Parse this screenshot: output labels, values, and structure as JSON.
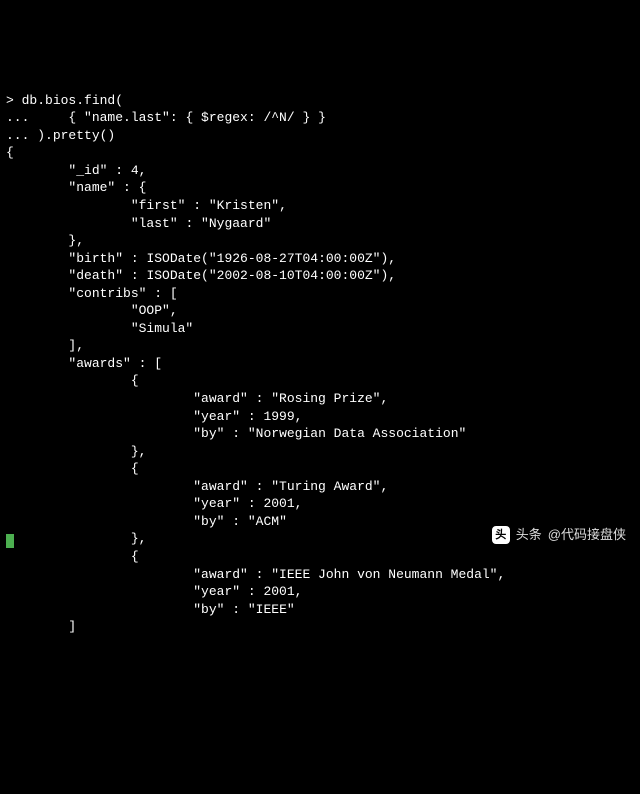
{
  "prompt": "> ",
  "continuation": "... ",
  "command": {
    "line1": "db.bios.find(",
    "line2": "    { \"name.last\": { $regex: /^N/ } }",
    "line3": ").pretty()"
  },
  "result": {
    "open": "{",
    "id_key": "\"_id\"",
    "id_val": "4",
    "name_key": "\"name\"",
    "name_open": "{",
    "first_key": "\"first\"",
    "first_val": "\"Kristen\"",
    "last_key": "\"last\"",
    "last_val": "\"Nygaard\"",
    "name_close": "}",
    "birth_key": "\"birth\"",
    "birth_val": "ISODate(\"1926-08-27T04:00:00Z\")",
    "death_key": "\"death\"",
    "death_val": "ISODate(\"2002-08-10T04:00:00Z\")",
    "contribs_key": "\"contribs\"",
    "contribs_open": "[",
    "contrib1": "\"OOP\"",
    "contrib2": "\"Simula\"",
    "contribs_close": "]",
    "awards_key": "\"awards\"",
    "awards_open": "[",
    "obj_open": "{",
    "award_key": "\"award\"",
    "year_key": "\"year\"",
    "by_key": "\"by\"",
    "a1_award": "\"Rosing Prize\"",
    "a1_year": "1999",
    "a1_by": "\"Norwegian Data Association\"",
    "a2_award": "\"Turing Award\"",
    "a2_year": "2001",
    "a2_by": "\"ACM\"",
    "a3_award": "\"IEEE John von Neumann Medal\"",
    "a3_year": "2001",
    "a3_by": "\"IEEE\"",
    "obj_close_comma": "},",
    "awards_close": "]"
  },
  "watermark": {
    "brand": "头条",
    "handle": "@代码接盘侠",
    "icon_text": "头"
  }
}
